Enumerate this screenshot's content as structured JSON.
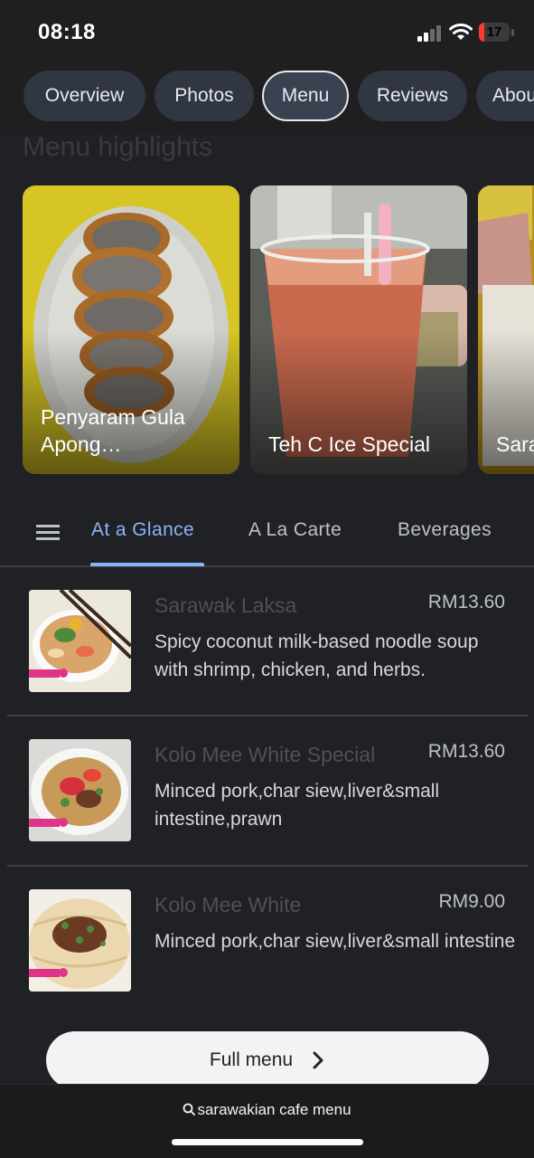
{
  "status_bar": {
    "time": "08:18",
    "battery_level": "17",
    "battery_color": "#ff3b30"
  },
  "place_tabs": [
    {
      "label": "Overview"
    },
    {
      "label": "Photos"
    },
    {
      "label": "Menu",
      "active": true
    },
    {
      "label": "Reviews"
    },
    {
      "label": "About"
    }
  ],
  "section_heading": "Menu highlights",
  "highlights": [
    {
      "label": "Penyaram Gula Apong…",
      "image": "penyaram-photo"
    },
    {
      "label": "Teh C Ice Special",
      "image": "iced-tea-photo"
    },
    {
      "label": "Sarawak Laksa",
      "image": "laksa-photo"
    }
  ],
  "menu_tabs": {
    "list_icon": "list-icon",
    "tabs": [
      {
        "label": "At a Glance",
        "active": true
      },
      {
        "label": "A La Carte"
      },
      {
        "label": "Beverages"
      }
    ]
  },
  "items": [
    {
      "name": "Sarawak Laksa",
      "price": "RM13.60",
      "description": "Spicy coconut milk-based noodle soup with shrimp, chicken, and herbs."
    },
    {
      "name": "Kolo Mee White Special",
      "price": "RM13.60",
      "description": "Minced pork,char siew,liver&small intestine,prawn"
    },
    {
      "name": "Kolo Mee White",
      "price": "RM9.00",
      "description": "Minced pork,char siew,liver&small intestine"
    }
  ],
  "full_menu_button": {
    "label": "Full menu",
    "icon": "chevron-right-icon"
  },
  "browser_bar": {
    "url": "sarawakian cafe menu",
    "icon": "search-icon"
  },
  "colors": {
    "background": "#202124",
    "accent": "#8ab4f8",
    "chip": "#303642"
  }
}
